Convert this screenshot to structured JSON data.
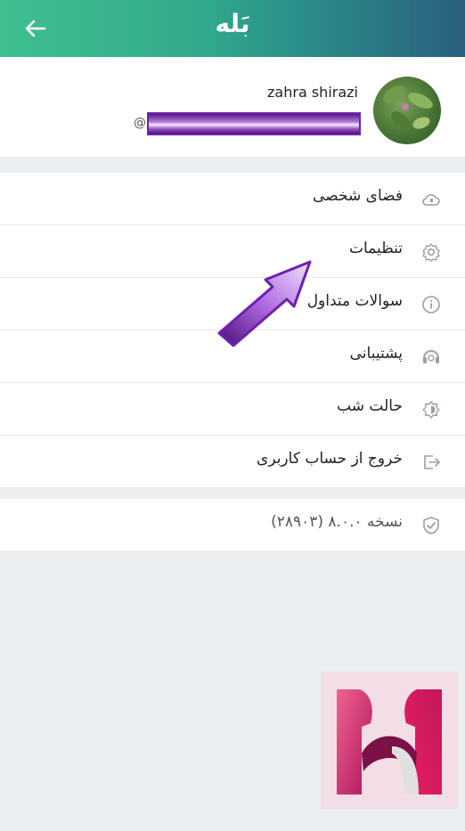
{
  "header": {
    "title": "بَله",
    "back_icon": "arrow-left-icon",
    "gradient": [
      "#3fbf8f",
      "#2b5f7e"
    ]
  },
  "profile": {
    "name": "zahra shirazi",
    "handle_prefix": "@"
  },
  "menu": {
    "items": [
      {
        "label": "فضای شخصی",
        "icon": "cloud-icon"
      },
      {
        "label": "تنظیمات",
        "icon": "gear-icon"
      },
      {
        "label": "سوالات متداول",
        "icon": "info-icon"
      },
      {
        "label": "پشتیبانی",
        "icon": "support-icon"
      },
      {
        "label": "حالت شب",
        "icon": "night-mode-icon"
      },
      {
        "label": "خروج از حساب کاربری",
        "icon": "logout-icon"
      }
    ]
  },
  "version": {
    "label": "نسخه ۸.۰.۰ (۲۸۹۰۳)",
    "icon": "check-shield-icon"
  },
  "colors": {
    "background": "#eceff1",
    "icon_gray": "#9aa0a6",
    "annotation_arrow": "#8a2be2",
    "redaction": "#6d24a8",
    "logo_pink": "#d6336c"
  }
}
